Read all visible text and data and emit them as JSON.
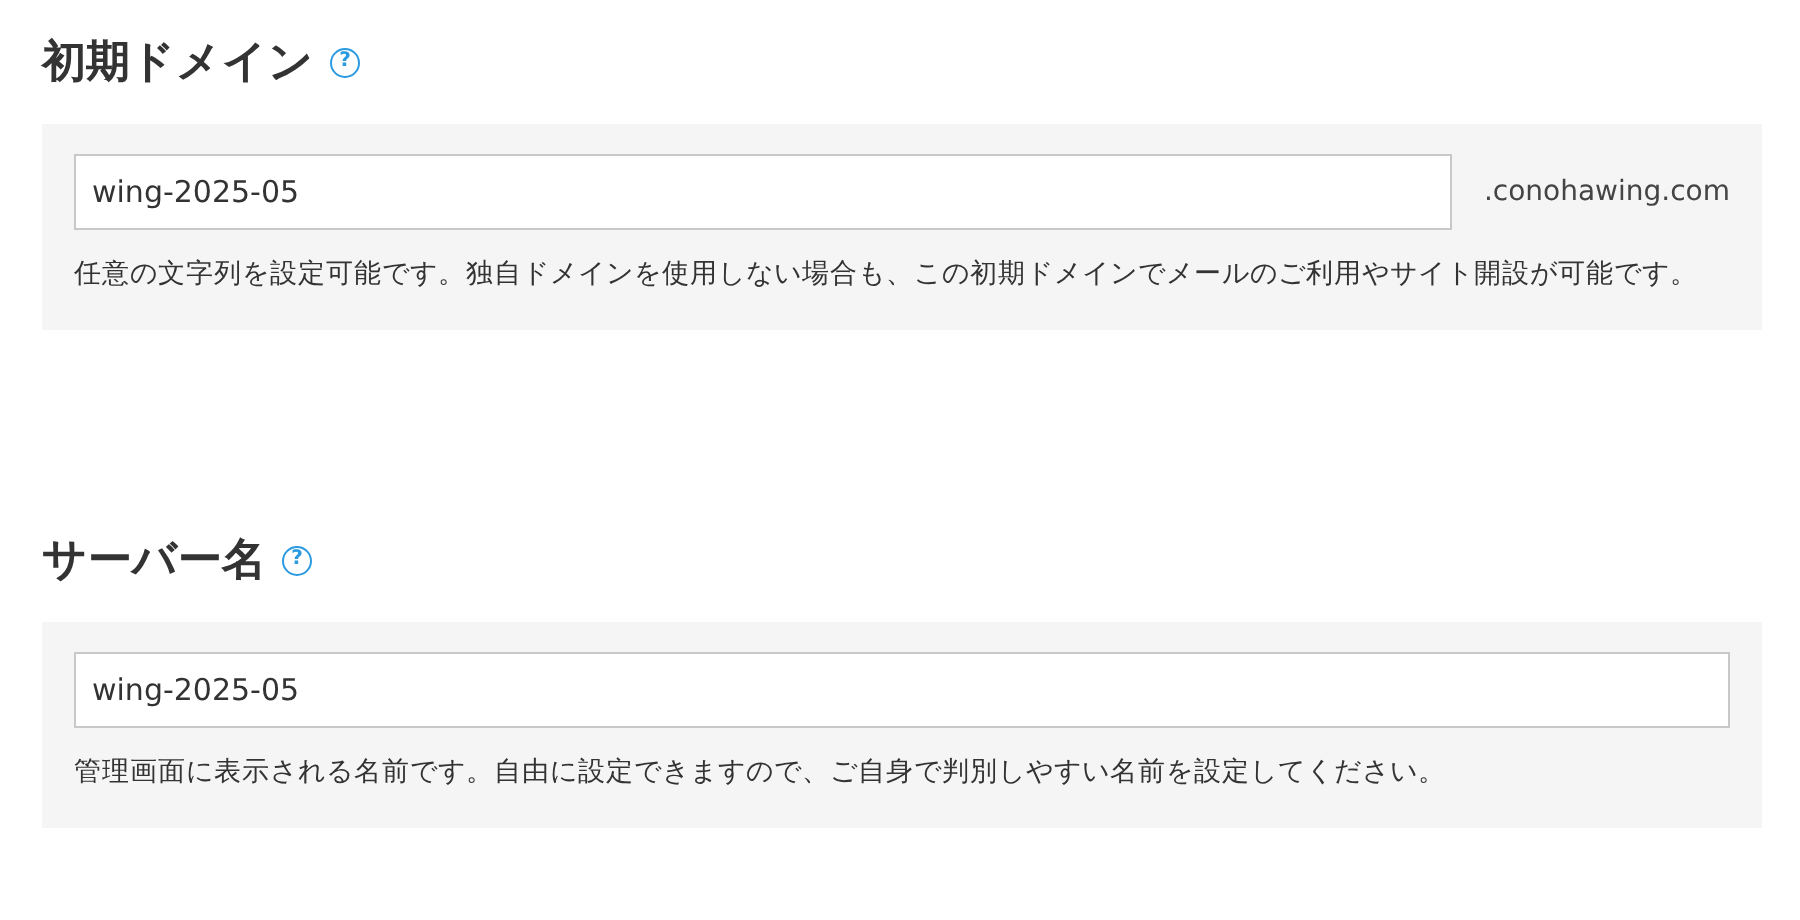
{
  "sections": [
    {
      "title": "初期ドメイン",
      "help": "?",
      "value": "wing-2025-05",
      "suffix": ".conohawing.com",
      "description": "任意の文字列を設定可能です。独自ドメインを使用しない場合も、この初期ドメインでメールのご利用やサイト開設が可能です。"
    },
    {
      "title": "サーバー名",
      "help": "?",
      "value": "wing-2025-05",
      "description": "管理画面に表示される名前です。自由に設定できますので、ご自身で判別しやすい名前を設定してください。"
    }
  ]
}
